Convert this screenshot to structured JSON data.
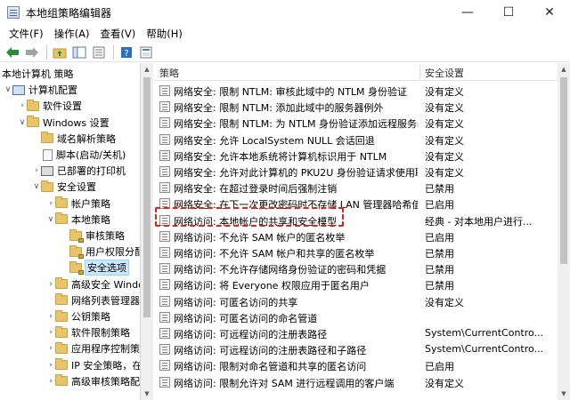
{
  "window": {
    "title": "本地组策略编辑器",
    "minimize": "—",
    "maximize": "☐",
    "close": "✕"
  },
  "menu": [
    "文件(F)",
    "操作(A)",
    "查看(V)",
    "帮助(H)"
  ],
  "tree": [
    {
      "label": "本地计算机 策略",
      "level": 0,
      "chev": "",
      "icon": "none"
    },
    {
      "label": "计算机配置",
      "level": 0,
      "chev": "∨",
      "icon": "pc"
    },
    {
      "label": "软件设置",
      "level": 1,
      "chev": "›",
      "icon": "folder"
    },
    {
      "label": "Windows 设置",
      "level": 1,
      "chev": "∨",
      "icon": "folder"
    },
    {
      "label": "域名解析策略",
      "level": 2,
      "chev": "",
      "icon": "folder"
    },
    {
      "label": "脚本(启动/关机)",
      "level": 2,
      "chev": "",
      "icon": "doc"
    },
    {
      "label": "已部署的打印机",
      "level": 2,
      "chev": "›",
      "icon": "printer"
    },
    {
      "label": "安全设置",
      "level": 2,
      "chev": "∨",
      "icon": "folder"
    },
    {
      "label": "帐户策略",
      "level": 3,
      "chev": "›",
      "icon": "folder"
    },
    {
      "label": "本地策略",
      "level": 3,
      "chev": "∨",
      "icon": "folder"
    },
    {
      "label": "审核策略",
      "level": 4,
      "chev": "",
      "icon": "folder-lock"
    },
    {
      "label": "用户权限分配",
      "level": 4,
      "chev": "",
      "icon": "folder-lock"
    },
    {
      "label": "安全选项",
      "level": 4,
      "chev": "",
      "icon": "folder-lock",
      "selected": true
    },
    {
      "label": "高级安全 Windows",
      "level": 3,
      "chev": "›",
      "icon": "folder"
    },
    {
      "label": "网络列表管理器策略",
      "level": 3,
      "chev": "",
      "icon": "folder"
    },
    {
      "label": "公钥策略",
      "level": 3,
      "chev": "›",
      "icon": "folder"
    },
    {
      "label": "软件限制策略",
      "level": 3,
      "chev": "›",
      "icon": "folder"
    },
    {
      "label": "应用程序控制策略",
      "level": 3,
      "chev": "›",
      "icon": "folder"
    },
    {
      "label": "IP 安全策略，在 本",
      "level": 3,
      "chev": "›",
      "icon": "folder"
    },
    {
      "label": "高级审核策略配置",
      "level": 3,
      "chev": "›",
      "icon": "folder"
    }
  ],
  "columns": {
    "policy": "策略",
    "setting": "安全设置"
  },
  "policies": [
    {
      "name": "网络安全: 限制 NTLM: 审核此域中的 NTLM 身份验证",
      "setting": "没有定义"
    },
    {
      "name": "网络安全: 限制 NTLM: 添加此域中的服务器例外",
      "setting": "没有定义"
    },
    {
      "name": "网络安全: 限制 NTLM: 为 NTLM 身份验证添加远程服务器...",
      "setting": "没有定义"
    },
    {
      "name": "网络安全: 允许 LocalSystem NULL 会话回退",
      "setting": "没有定义"
    },
    {
      "name": "网络安全: 允许本地系统将计算机标识用于 NTLM",
      "setting": "没有定义"
    },
    {
      "name": "网络安全: 允许对此计算机的 PKU2U 身份验证请求使用联...",
      "setting": "没有定义"
    },
    {
      "name": "网络安全: 在超过登录时间后强制注销",
      "setting": "已禁用"
    },
    {
      "name": "网络安全: 在下一次更改密码时不存储 LAN 管理器哈希值",
      "setting": "已启用"
    },
    {
      "name": "网络访问: 本地帐户的共享和安全模型",
      "setting": "经典 - 对本地用户进行..."
    },
    {
      "name": "网络访问: 不允许 SAM 帐户的匿名枚举",
      "setting": "已启用"
    },
    {
      "name": "网络访问: 不允许 SAM 帐户和共享的匿名枚举",
      "setting": "已禁用"
    },
    {
      "name": "网络访问: 不允许存储网络身份验证的密码和凭据",
      "setting": "已禁用"
    },
    {
      "name": "网络访问: 将 Everyone 权限应用于匿名用户",
      "setting": "已禁用"
    },
    {
      "name": "网络访问: 可匿名访问的共享",
      "setting": "没有定义"
    },
    {
      "name": "网络访问: 可匿名访问的命名管道",
      "setting": ""
    },
    {
      "name": "网络访问: 可远程访问的注册表路径",
      "setting": "System\\CurrentContro..."
    },
    {
      "name": "网络访问: 可远程访问的注册表路径和子路径",
      "setting": "System\\CurrentContro..."
    },
    {
      "name": "网络访问: 限制对命名管道和共享的匿名访问",
      "setting": "已启用"
    },
    {
      "name": "网络访问: 限制允许对 SAM 进行远程调用的客户端",
      "setting": "没有定义"
    }
  ]
}
